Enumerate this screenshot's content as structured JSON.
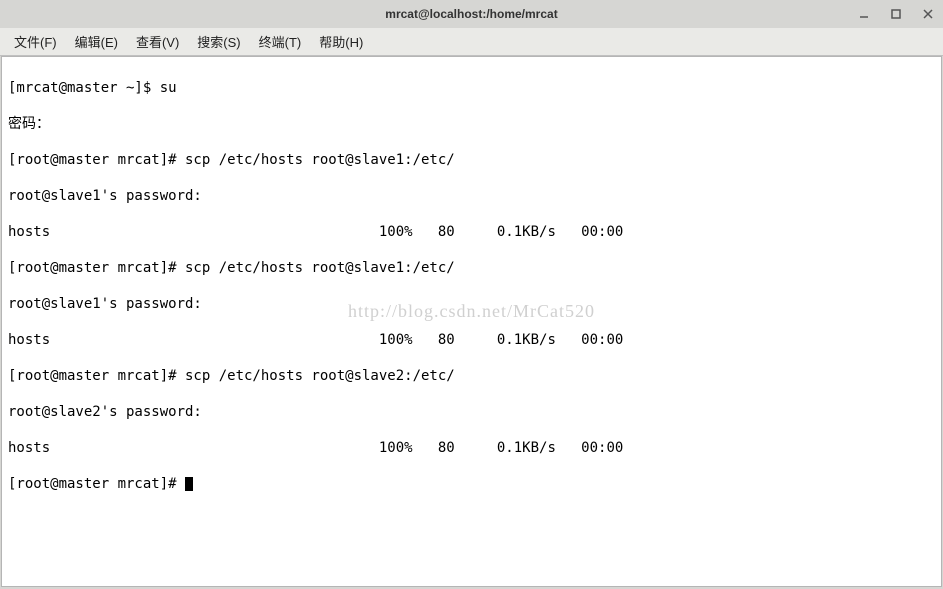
{
  "window": {
    "title": "mrcat@localhost:/home/mrcat"
  },
  "menu": {
    "file": "文件(F)",
    "edit": "编辑(E)",
    "view": "查看(V)",
    "search": "搜索(S)",
    "terminal": "终端(T)",
    "help": "帮助(H)"
  },
  "terminal": {
    "lines": [
      "[mrcat@master ~]$ su",
      "密码：",
      "[root@master mrcat]# scp /etc/hosts root@slave1:/etc/",
      "root@slave1's password:",
      "hosts                                       100%   80     0.1KB/s   00:00",
      "[root@master mrcat]# scp /etc/hosts root@slave1:/etc/",
      "root@slave1's password:",
      "hosts                                       100%   80     0.1KB/s   00:00",
      "[root@master mrcat]# scp /etc/hosts root@slave2:/etc/",
      "root@slave2's password:",
      "hosts                                       100%   80     0.1KB/s   00:00"
    ],
    "prompt": "[root@master mrcat]# "
  },
  "watermark": "http://blog.csdn.net/MrCat520"
}
